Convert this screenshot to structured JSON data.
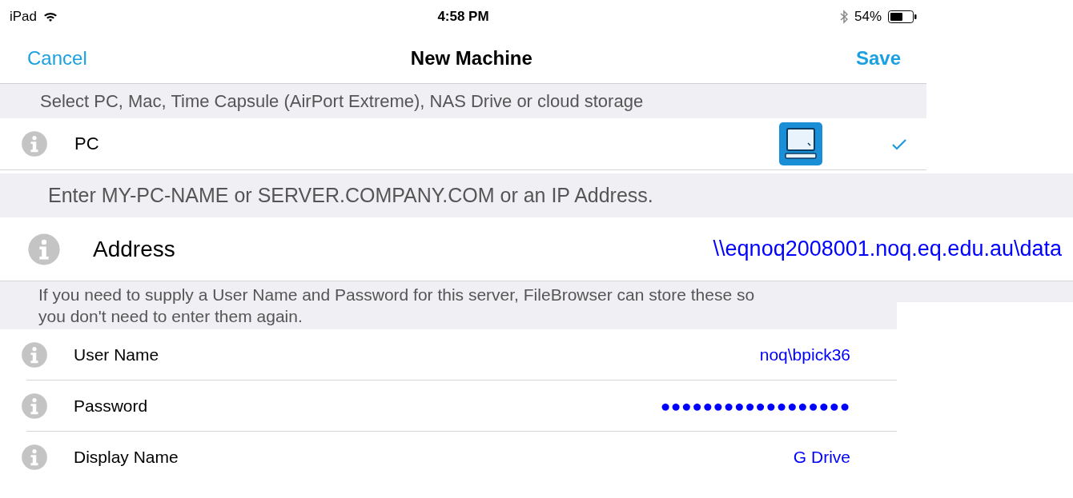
{
  "status_bar": {
    "device": "iPad",
    "time": "4:58 PM",
    "battery": "54%"
  },
  "nav": {
    "cancel": "Cancel",
    "title": "New Machine",
    "save": "Save"
  },
  "sections": [
    {
      "header": "Select PC, Mac, Time Capsule (AirPort Extreme), NAS Drive or cloud storage",
      "rows": [
        {
          "kind": "device",
          "label": "PC",
          "selected": true
        }
      ]
    },
    {
      "header": "Enter MY-PC-NAME or SERVER.COMPANY.COM or an IP Address.",
      "rows": [
        {
          "kind": "field",
          "label": "Address",
          "value": "\\\\eqnoq2008001.noq.eq.edu.au\\data"
        }
      ]
    },
    {
      "header": "If you need to supply a User Name and Password for this server, FileBrowser can store these so you don't need to enter them again.",
      "rows": [
        {
          "kind": "field",
          "label": "User Name",
          "value": "noq\\bpick36"
        },
        {
          "kind": "secret",
          "label": "Password",
          "value": "●●●●●●●●●●●●●●●●●●"
        },
        {
          "kind": "field",
          "label": "Display Name",
          "value": "G Drive"
        }
      ]
    }
  ]
}
